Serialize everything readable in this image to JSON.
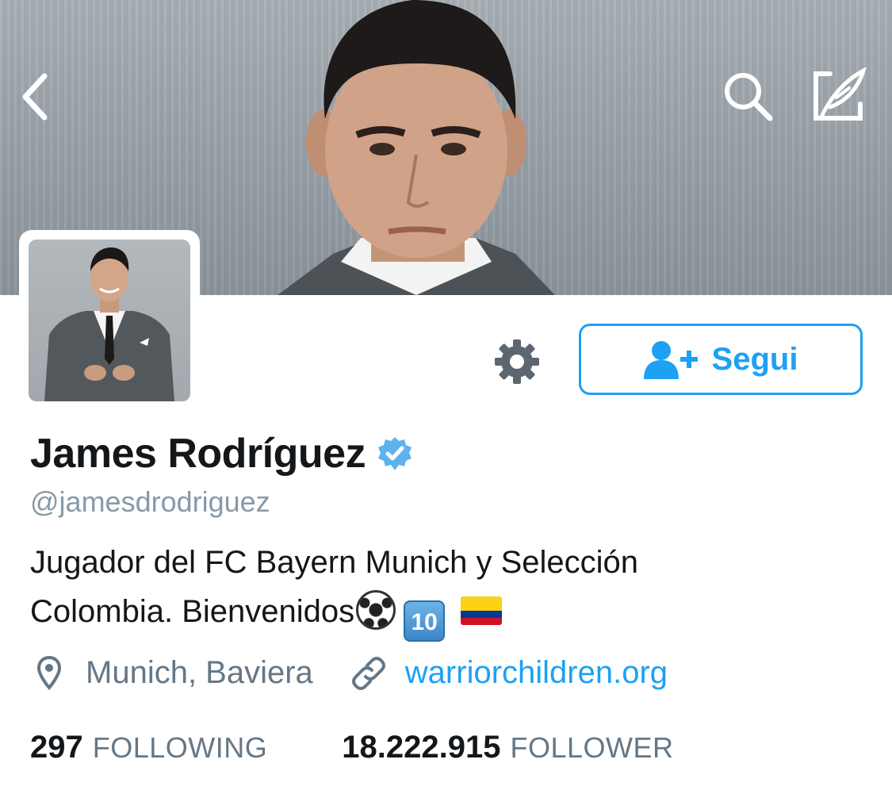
{
  "header": {
    "back_icon": "chevron-left-icon",
    "search_icon": "search-icon",
    "compose_icon": "compose-tweet-icon"
  },
  "profile": {
    "display_name": "James Rodríguez",
    "verified": true,
    "handle": "@jamesdrodriguez",
    "bio_line1": "Jugador del FC Bayern Munich y Selección",
    "bio_line2": "Colombia. Bienvenidos",
    "bio_emojis": [
      "soccer-ball",
      "keycap-ten",
      "flag-colombia"
    ],
    "location": "Munich, Baviera",
    "website": "warriorchildren.org"
  },
  "actions": {
    "settings_icon": "gear-icon",
    "follow_label": "Segui",
    "follow_icon": "add-user-icon"
  },
  "stats": {
    "following_count": "297",
    "following_label": "FOLLOWING",
    "followers_count": "18.222.915",
    "followers_label": "FOLLOWER"
  },
  "colors": {
    "accent": "#1da1f2",
    "secondary_text": "#657786",
    "primary_text": "#14171a",
    "icon_gray": "#5c6670"
  }
}
